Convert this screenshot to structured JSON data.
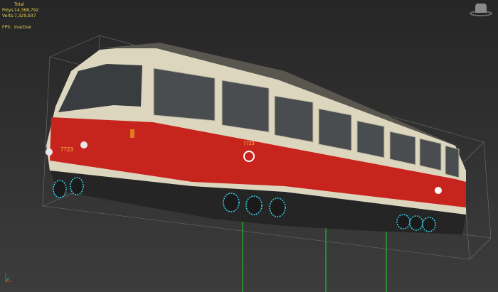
{
  "stats": {
    "header": "Total",
    "polys_label": "Polys:",
    "polys_value": "14,368,792",
    "verts_label": "Verts:",
    "verts_value": "7,329,937",
    "fps_label": "FPS:",
    "fps_value": "Inactive"
  },
  "model": {
    "fleet_number_front": "7723",
    "fleet_number_side": "7723"
  },
  "colors": {
    "red": "#c8241e",
    "cream": "#ddd6be",
    "accent_blue": "#35d6f0",
    "grid_green": "#1fbf2a",
    "stats_text": "#e6d24a"
  }
}
